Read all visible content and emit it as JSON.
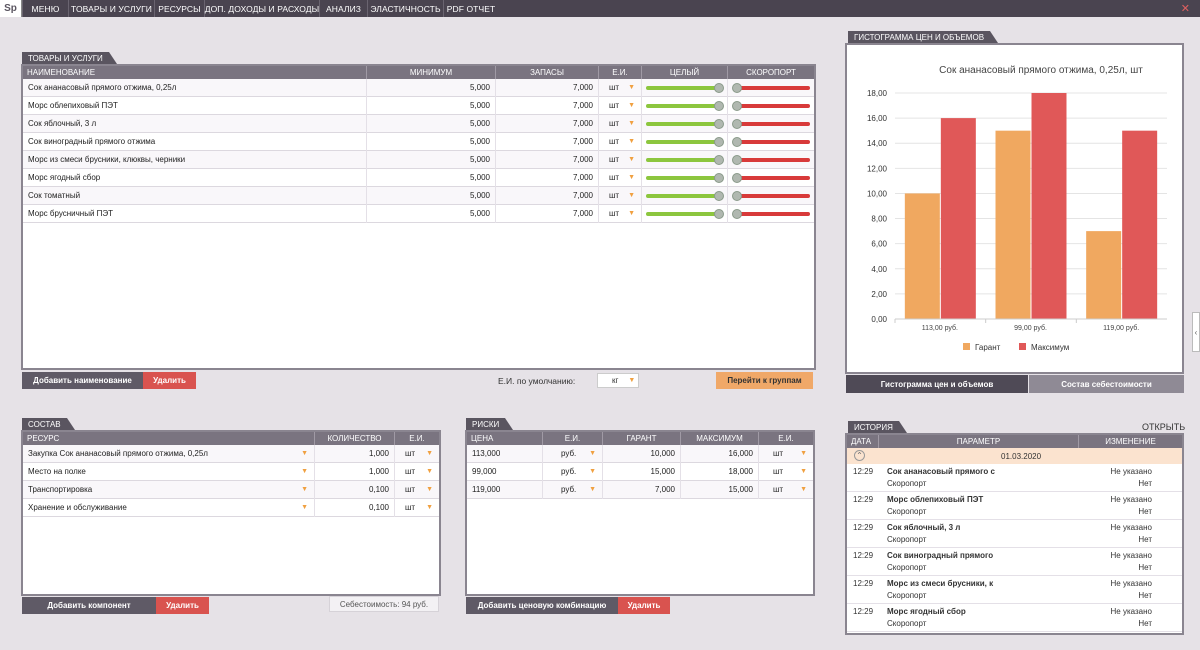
{
  "app": {
    "logo": "Sp",
    "close": "✕"
  },
  "menu": [
    {
      "label": "МЕНЮ",
      "color": "#4a4450"
    },
    {
      "label": "ТОВАРЫ И УСЛУГИ",
      "color": "#f0a040"
    },
    {
      "label": "РЕСУРСЫ",
      "color": "#7dc040"
    },
    {
      "label": "ДОП. ДОХОДЫ И РАСХОДЫ",
      "color": "#a0c060"
    },
    {
      "label": "АНАЛИЗ",
      "color": "#b050c0"
    },
    {
      "label": "ЭЛАСТИЧНОСТЬ",
      "color": "#c060d0"
    },
    {
      "label": "PDF ОТЧЕТ",
      "color": "#e05050"
    }
  ],
  "products": {
    "title": "ТОВАРЫ И УСЛУГИ",
    "columns": [
      "НАИМЕНОВАНИЕ",
      "МИНИМУМ",
      "ЗАПАСЫ",
      "Е.И.",
      "ЦЕЛЫЙ",
      "СКОРОПОРТ"
    ],
    "rows": [
      {
        "name": "Сок ананасовый прямого отжима, 0,25л",
        "min": "5,000",
        "stock": "7,000",
        "unit": "шт"
      },
      {
        "name": "Морс облепиховый ПЭТ",
        "min": "5,000",
        "stock": "7,000",
        "unit": "шт"
      },
      {
        "name": "Сок яблочный, 3 л",
        "min": "5,000",
        "stock": "7,000",
        "unit": "шт"
      },
      {
        "name": "Сок виноградный прямого отжима",
        "min": "5,000",
        "stock": "7,000",
        "unit": "шт"
      },
      {
        "name": "Морс из смеси брусники, клюквы, черники",
        "min": "5,000",
        "stock": "7,000",
        "unit": "шт"
      },
      {
        "name": "Морс ягодный сбор",
        "min": "5,000",
        "stock": "7,000",
        "unit": "шт"
      },
      {
        "name": "Сок томатный",
        "min": "5,000",
        "stock": "7,000",
        "unit": "шт"
      },
      {
        "name": "Морс брусничный ПЭТ",
        "min": "5,000",
        "stock": "7,000",
        "unit": "шт"
      }
    ],
    "whole_level": 1.0,
    "perishable_level": 0.0,
    "add_button": "Добавить наименование",
    "delete_button": "Удалить",
    "default_unit_label": "Е.И. по умолчанию:",
    "default_unit_value": "кг",
    "groups_button": "Перейти к группам"
  },
  "composition": {
    "title": "СОСТАВ",
    "columns": [
      "РЕСУРС",
      "КОЛИЧЕСТВО",
      "Е.И."
    ],
    "rows": [
      {
        "resource": "Закупка Сок ананасовый прямого отжима, 0,25л",
        "qty": "1,000",
        "unit": "шт"
      },
      {
        "resource": "Место на полке",
        "qty": "1,000",
        "unit": "шт"
      },
      {
        "resource": "Транспортировка",
        "qty": "0,100",
        "unit": "шт"
      },
      {
        "resource": "Хранение и обслуживание",
        "qty": "0,100",
        "unit": "шт"
      }
    ],
    "add_button": "Добавить компонент",
    "delete_button": "Удалить",
    "cost_label": "Себестоимость: 94 руб."
  },
  "risks": {
    "title": "РИСКИ",
    "columns": [
      "ЦЕНА",
      "Е.И.",
      "ГАРАНТ",
      "МАКСИМУМ",
      "Е.И."
    ],
    "rows": [
      {
        "price": "113,000",
        "cur": "руб.",
        "guarantee": "10,000",
        "max": "16,000",
        "unit": "шт"
      },
      {
        "price": "99,000",
        "cur": "руб.",
        "guarantee": "15,000",
        "max": "18,000",
        "unit": "шт"
      },
      {
        "price": "119,000",
        "cur": "руб.",
        "guarantee": "7,000",
        "max": "15,000",
        "unit": "шт"
      }
    ],
    "add_button": "Добавить ценовую комбинацию",
    "delete_button": "Удалить"
  },
  "histogram": {
    "panel_title": "ГИСТОГРАММА ЦЕН И ОБЪЕМОВ",
    "tab_active": "Гистограмма цен и объемов",
    "tab_inactive": "Состав себестоимости"
  },
  "chart_data": {
    "type": "bar",
    "title": "Сок ананасовый прямого отжима, 0,25л, шт",
    "categories": [
      "113,00 руб.",
      "99,00 руб.",
      "119,00 руб."
    ],
    "series": [
      {
        "name": "Гарант",
        "values": [
          10,
          15,
          7
        ],
        "color": "#f0a860"
      },
      {
        "name": "Максимум",
        "values": [
          16,
          18,
          15
        ],
        "color": "#e05858"
      }
    ],
    "ylim": [
      0,
      18
    ],
    "yticks": [
      "0,00",
      "2,00",
      "4,00",
      "6,00",
      "8,00",
      "10,00",
      "12,00",
      "14,00",
      "16,00",
      "18,00"
    ],
    "legend": "bottom",
    "grid": true
  },
  "history": {
    "title": "ИСТОРИЯ",
    "open_label": "ОТКРЫТЬ",
    "columns": [
      "ДАТА",
      "ПАРАМЕТР",
      "ИЗМЕНЕНИЕ"
    ],
    "date_group": "01.03.2020",
    "collapse_icon": "⌃",
    "rows": [
      {
        "time": "12:29",
        "param": "Сок ананасовый прямого с",
        "sub": "Скоропорт",
        "change": "Не указано",
        "change2": "Нет"
      },
      {
        "time": "12:29",
        "param": "Морс облепиховый ПЭТ",
        "sub": "Скоропорт",
        "change": "Не указано",
        "change2": "Нет"
      },
      {
        "time": "12:29",
        "param": "Сок яблочный, 3 л",
        "sub": "Скоропорт",
        "change": "Не указано",
        "change2": "Нет"
      },
      {
        "time": "12:29",
        "param": "Сок виноградный прямого",
        "sub": "Скоропорт",
        "change": "Не указано",
        "change2": "Нет"
      },
      {
        "time": "12:29",
        "param": "Морс из смеси брусники, к",
        "sub": "Скоропорт",
        "change": "Не указано",
        "change2": "Нет"
      },
      {
        "time": "12:29",
        "param": "Морс ягодный сбор",
        "sub": "Скоропорт",
        "change": "Не указано",
        "change2": "Нет"
      }
    ]
  },
  "side_handle": "‹"
}
